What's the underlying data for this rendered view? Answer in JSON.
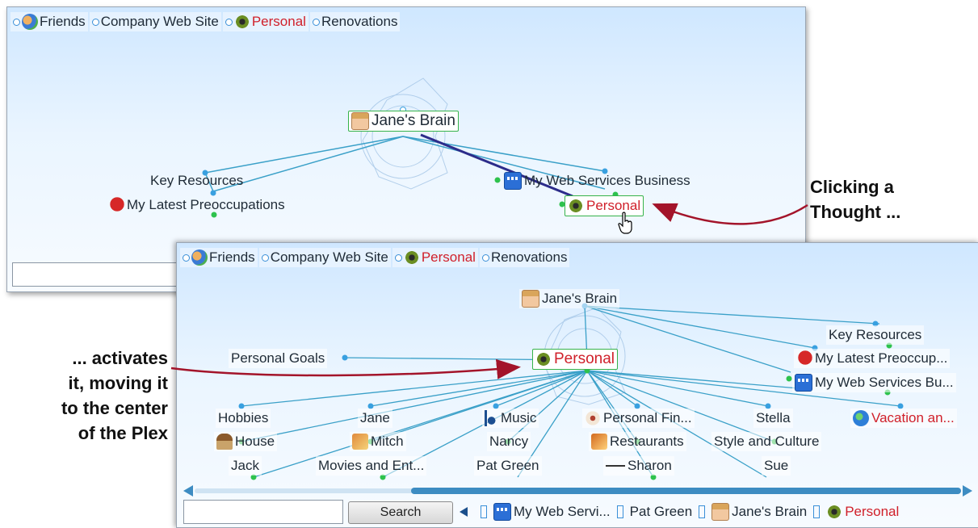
{
  "brainA": {
    "pins": [
      {
        "label": "Friends",
        "icon": "friends-icon",
        "color": "#1e2a36"
      },
      {
        "label": "Company Web Site",
        "icon": "",
        "color": "#1e2a36"
      },
      {
        "label": "Personal",
        "icon": "moth-icon",
        "color": "#d0202a"
      },
      {
        "label": "Renovations",
        "icon": "",
        "color": "#1e2a36"
      }
    ],
    "center": {
      "label": "Jane's Brain",
      "icon": "face-icon"
    },
    "children": [
      {
        "label": "Key Resources"
      },
      {
        "label": "My Latest Preoccupations",
        "icon": "heart-icon"
      },
      {
        "label": "My Web Services Business",
        "icon": "web-icon"
      },
      {
        "label": "Personal",
        "icon": "moth-icon",
        "color": "#d0202a"
      }
    ],
    "search_value": ""
  },
  "brainB": {
    "pins": [
      {
        "label": "Friends",
        "icon": "friends-icon"
      },
      {
        "label": "Company Web Site",
        "icon": ""
      },
      {
        "label": "Personal",
        "icon": "moth-icon",
        "color": "#d0202a"
      },
      {
        "label": "Renovations",
        "icon": ""
      }
    ],
    "parent": {
      "label": "Jane's Brain",
      "icon": "face-icon"
    },
    "center": {
      "label": "Personal",
      "icon": "moth-icon",
      "color": "#d0202a"
    },
    "jump": {
      "label": "Personal Goals"
    },
    "siblings": [
      {
        "label": "Key Resources"
      },
      {
        "label": "My Latest Preoccup...",
        "icon": "heart-icon"
      },
      {
        "label": "My Web Services Bu...",
        "icon": "web-icon"
      }
    ],
    "children": [
      {
        "label": "Hobbies"
      },
      {
        "label": "Jane"
      },
      {
        "label": "Music",
        "icon": "music-note-icon"
      },
      {
        "label": "Personal Fin...",
        "icon": "eye-icon"
      },
      {
        "label": "Stella"
      },
      {
        "label": "Vacation an...",
        "icon": "globe-icon",
        "color": "#d0202a"
      },
      {
        "label": "House",
        "icon": "house-icon"
      },
      {
        "label": "Mitch",
        "icon": "mitch-icon"
      },
      {
        "label": "Nancy"
      },
      {
        "label": "Restaurants",
        "icon": "restaurant-icon"
      },
      {
        "label": "Style and Culture"
      },
      {
        "label": "Jack"
      },
      {
        "label": "Movies and Ent..."
      },
      {
        "label": "Pat Green"
      },
      {
        "label": "Sharon",
        "icon": "line-icon"
      },
      {
        "label": "Sue"
      }
    ],
    "search_value": "",
    "search_button": "Search",
    "history": [
      {
        "label": "My Web Servi...",
        "icon": "web-icon"
      },
      {
        "label": "Pat Green",
        "icon": ""
      },
      {
        "label": "Jane's Brain",
        "icon": "face-icon"
      },
      {
        "label": "Personal",
        "icon": "moth-icon",
        "color": "#d0202a"
      }
    ]
  },
  "annotations": {
    "callout_click": "Clicking a\nThought ...",
    "callout_activate": "... activates\nit, moving it\nto the center\nof the Plex",
    "arrow_color": "#a3142a"
  },
  "colors": {
    "link": "#3aa0c8",
    "active_link": "#2c2c8a",
    "active_border": "#36b34a",
    "red_text": "#d0202a",
    "scroll": "#3d8cc2"
  }
}
